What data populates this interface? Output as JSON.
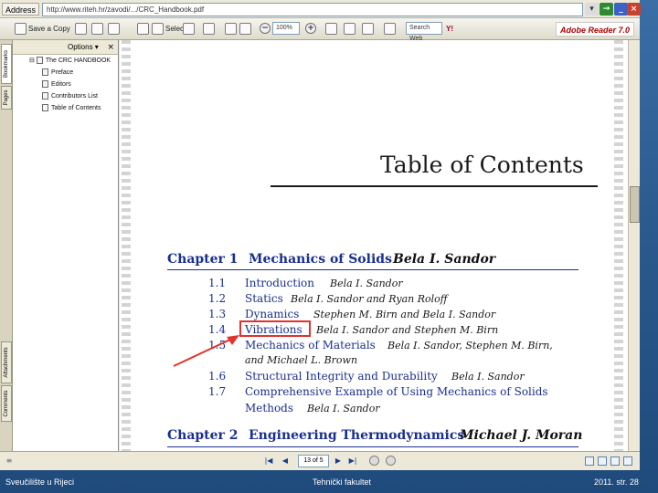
{
  "browser": {
    "address_label": "Address",
    "url": "http://www.riteh.hr/zavodi/.../CRC_Handbook.pdf"
  },
  "toolbar": {
    "save_label": "Save a Copy",
    "select_label": "Select",
    "zoom_value": "100%",
    "search_placeholder": "Search Web",
    "adobe_label": "Adobe Reader 7.0"
  },
  "nav_tabs": [
    "Bookmarks",
    "Pages",
    "Attachments",
    "Comments"
  ],
  "bookmarks": {
    "options_label": "Options",
    "items": [
      "The CRC HANDBOOK",
      "Preface",
      "Editors",
      "Contributors List",
      "Table of Contents"
    ]
  },
  "document": {
    "title": "Table of Contents",
    "chapter1": {
      "label": "Chapter 1",
      "title": "Mechanics of Solids",
      "author": "Bela I. Sandor",
      "sections": [
        {
          "num": "1.1",
          "title": "Introduction",
          "author": "Bela I. Sandor"
        },
        {
          "num": "1.2",
          "title": "Statics",
          "author": "Bela I. Sandor and Ryan Roloff"
        },
        {
          "num": "1.3",
          "title": "Dynamics",
          "author": "Stephen M. Birn and Bela I. Sandor"
        },
        {
          "num": "1.4",
          "title": "Vibrations",
          "author": "Bela I. Sandor and Stephen M. Birn"
        },
        {
          "num": "1.5",
          "title": "Mechanics of Materials",
          "author": "Bela I. Sandor, Stephen M. Birn,",
          "author2": "and Michael L. Brown"
        },
        {
          "num": "1.6",
          "title": "Structural Integrity and Durability",
          "author": "Bela I. Sandor"
        },
        {
          "num": "1.7",
          "title": "Comprehensive Example of Using Mechanics of Solids",
          "title2": "Methods",
          "author": "Bela I. Sandor"
        }
      ]
    },
    "chapter2": {
      "label": "Chapter 2",
      "title": "Engineering Thermodynamics",
      "author": "Michael J. Moran"
    }
  },
  "statusbar": {
    "page_value": "13 of 5"
  },
  "footer": {
    "left": "Sveučilište u Rijeci",
    "center": "Tehnički fakultet",
    "right": "2011.   str. 28"
  },
  "colors": {
    "link_blue": "#1a2f8f",
    "highlight_red": "#e0342c",
    "slide_bg": "#2b5a8e"
  }
}
